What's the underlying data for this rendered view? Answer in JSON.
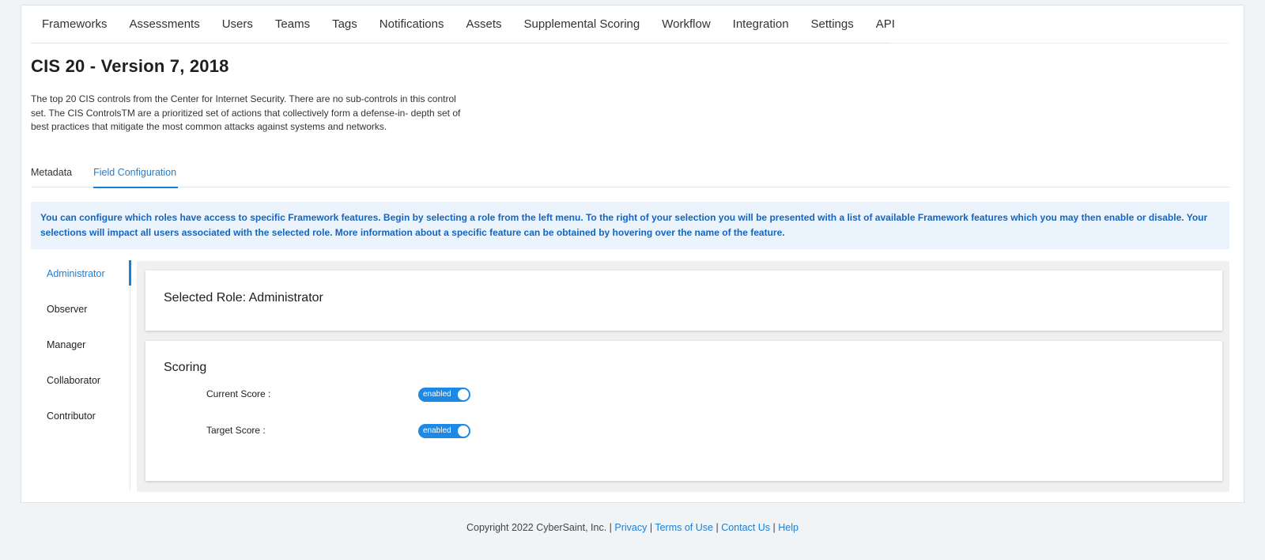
{
  "nav": {
    "items": [
      "Frameworks",
      "Assessments",
      "Users",
      "Teams",
      "Tags",
      "Notifications",
      "Assets",
      "Supplemental Scoring",
      "Workflow",
      "Integration",
      "Settings",
      "API"
    ]
  },
  "page": {
    "title": "CIS 20 - Version 7, 2018",
    "description": "The top 20 CIS controls from the Center for Internet Security. There are no sub-controls in this control set. The CIS ControlsTM are a prioritized set of actions that collectively form a defense-in- depth set of best practices that mitigate the most common attacks against systems and networks."
  },
  "tabs": [
    {
      "label": "Metadata",
      "active": false
    },
    {
      "label": "Field Configuration",
      "active": true
    }
  ],
  "info_text": "You can configure which roles have access to specific Framework features. Begin by selecting a role from the left menu. To the right of your selection you will be presented with a list of available Framework features which you may then enable or disable. Your selections will impact all users associated with the selected role. More information about a specific feature can be obtained by hovering over the name of the feature.",
  "roles": {
    "items": [
      "Administrator",
      "Observer",
      "Manager",
      "Collaborator",
      "Contributor"
    ],
    "selected": "Administrator"
  },
  "selected_role_text": "Selected Role: Administrator",
  "scoring": {
    "title": "Scoring",
    "fields": [
      {
        "label": "Current Score :",
        "toggle": "enabled"
      },
      {
        "label": "Target Score :",
        "toggle": "enabled"
      }
    ]
  },
  "footer": {
    "copyright": "Copyright 2022 CyberSaint, Inc.",
    "links": [
      "Privacy",
      "Terms of Use",
      "Contact Us",
      "Help"
    ]
  },
  "colors": {
    "accent": "#1a7fd6",
    "info_bg": "#ebf4fc",
    "toggle_on": "#1e88e5"
  }
}
